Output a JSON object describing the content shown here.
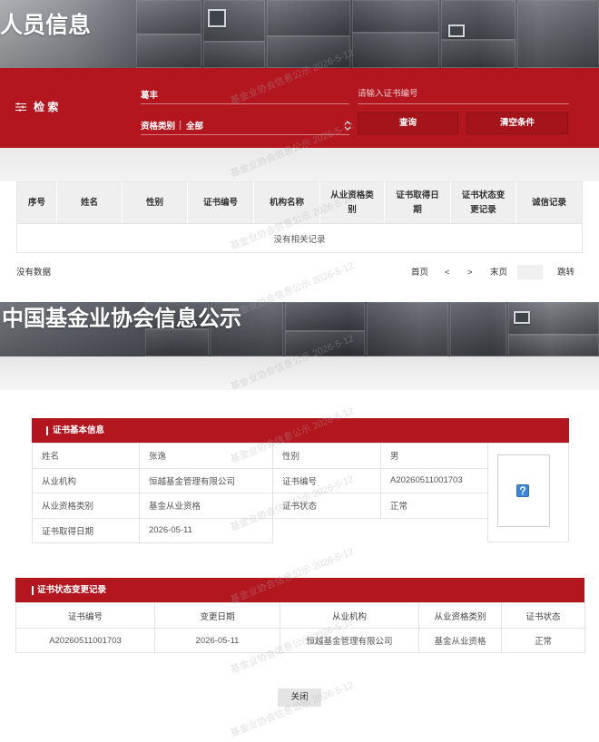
{
  "page1": {
    "title": "人员信息",
    "search": {
      "section_label": "检 索",
      "name_value": "葛丰",
      "cert_placeholder": "请输入证书编号",
      "category_label": "资格类别",
      "category_value": "全部",
      "query_button": "查询",
      "clear_button": "清空条件"
    },
    "table": {
      "headers": [
        "序号",
        "姓名",
        "性别",
        "证书编号",
        "机构名称",
        "从业资格类别",
        "证书取得日期",
        "证书状态变更记录",
        "诚信记录"
      ],
      "empty_text": "没有相关记录"
    },
    "pager": {
      "status": "没有数据",
      "first": "首页",
      "prev": "<",
      "next": ">",
      "last": "末页",
      "jump": "跳转"
    }
  },
  "page2": {
    "title": "中国基金业协会信息公示",
    "basic_info": {
      "heading": "证书基本信息",
      "rows": [
        {
          "label": "姓名",
          "value": "张逸",
          "label2": "性别",
          "value2": "男"
        },
        {
          "label": "从业机构",
          "value": "恒越基金管理有限公司",
          "label2": "证书编号",
          "value2": "A20260511001703"
        },
        {
          "label": "从业资格类别",
          "value": "基金从业资格",
          "label2": "证书状态",
          "value2": "正常"
        },
        {
          "label": "证书取得日期",
          "value": "2026-05-11"
        }
      ]
    },
    "change_log": {
      "heading": "证书状态变更记录",
      "headers": [
        "证书编号",
        "变更日期",
        "从业机构",
        "从业资格类别",
        "证书状态"
      ],
      "rows": [
        [
          "A20260511001703",
          "2026-05-11",
          "恒越基金管理有限公司",
          "基金从业资格",
          "正常"
        ]
      ]
    },
    "close_button": "关闭"
  },
  "watermark": "基金业协会信息公示 2026-5-12",
  "colors": {
    "accent_red": "#b3161f",
    "button_red": "#a5131b",
    "header_gray": "#efefef",
    "close_button_gray": "#e4e4e4"
  },
  "icons": {
    "search_section": "filter-icon",
    "category_select": "sort-arrows-icon",
    "photo": "broken-image-icon"
  }
}
